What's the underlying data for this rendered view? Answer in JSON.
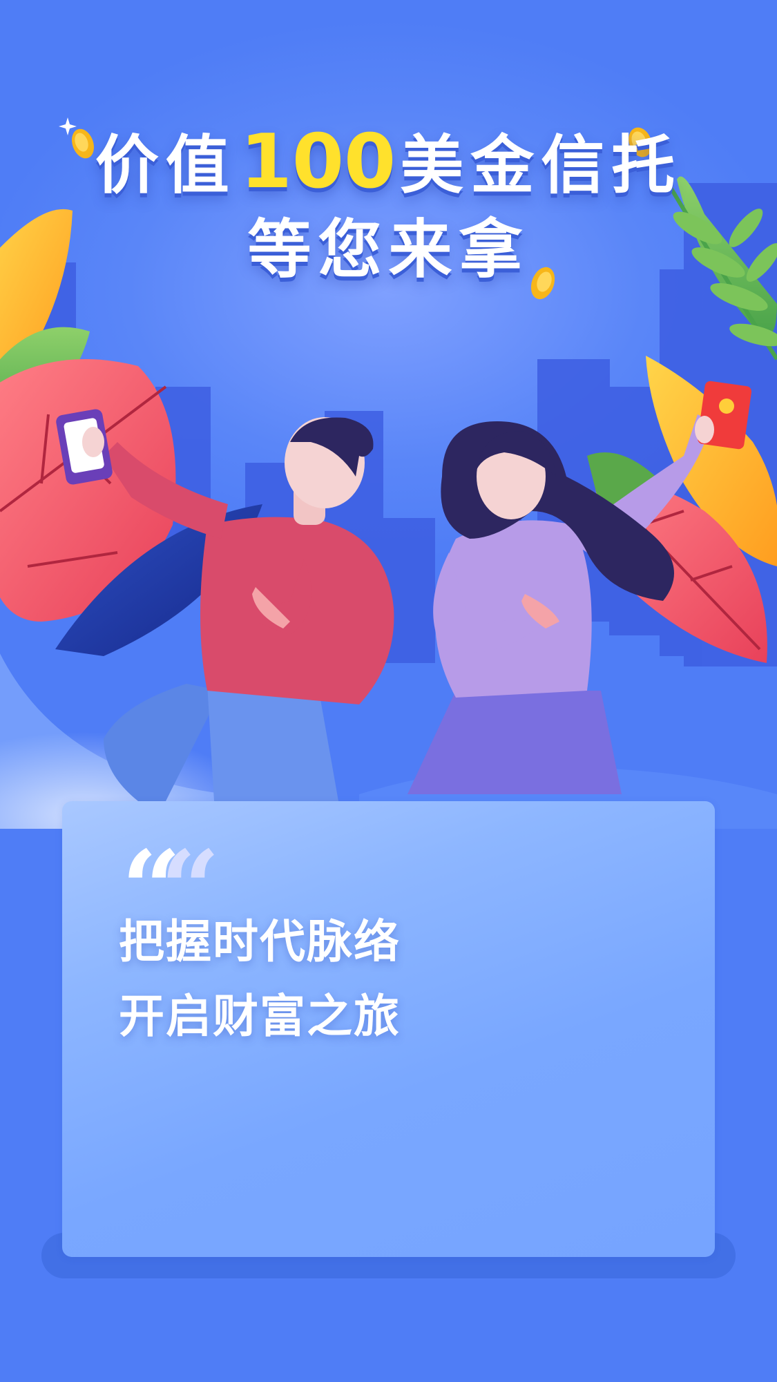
{
  "headline": {
    "prefix": "价值",
    "amount": "100",
    "suffix": "美金信托",
    "line2": "等您来拿"
  },
  "card": {
    "quote_mark": "“",
    "line1": "把握时代脉络",
    "line2": "开启财富之旅"
  },
  "colors": {
    "background": "#4f7df6",
    "amount": "#ffe12c",
    "card": "#8db6ff"
  },
  "icons": [
    "sparkle-icon",
    "coin-icon",
    "phone-icon",
    "red-envelope-icon"
  ]
}
